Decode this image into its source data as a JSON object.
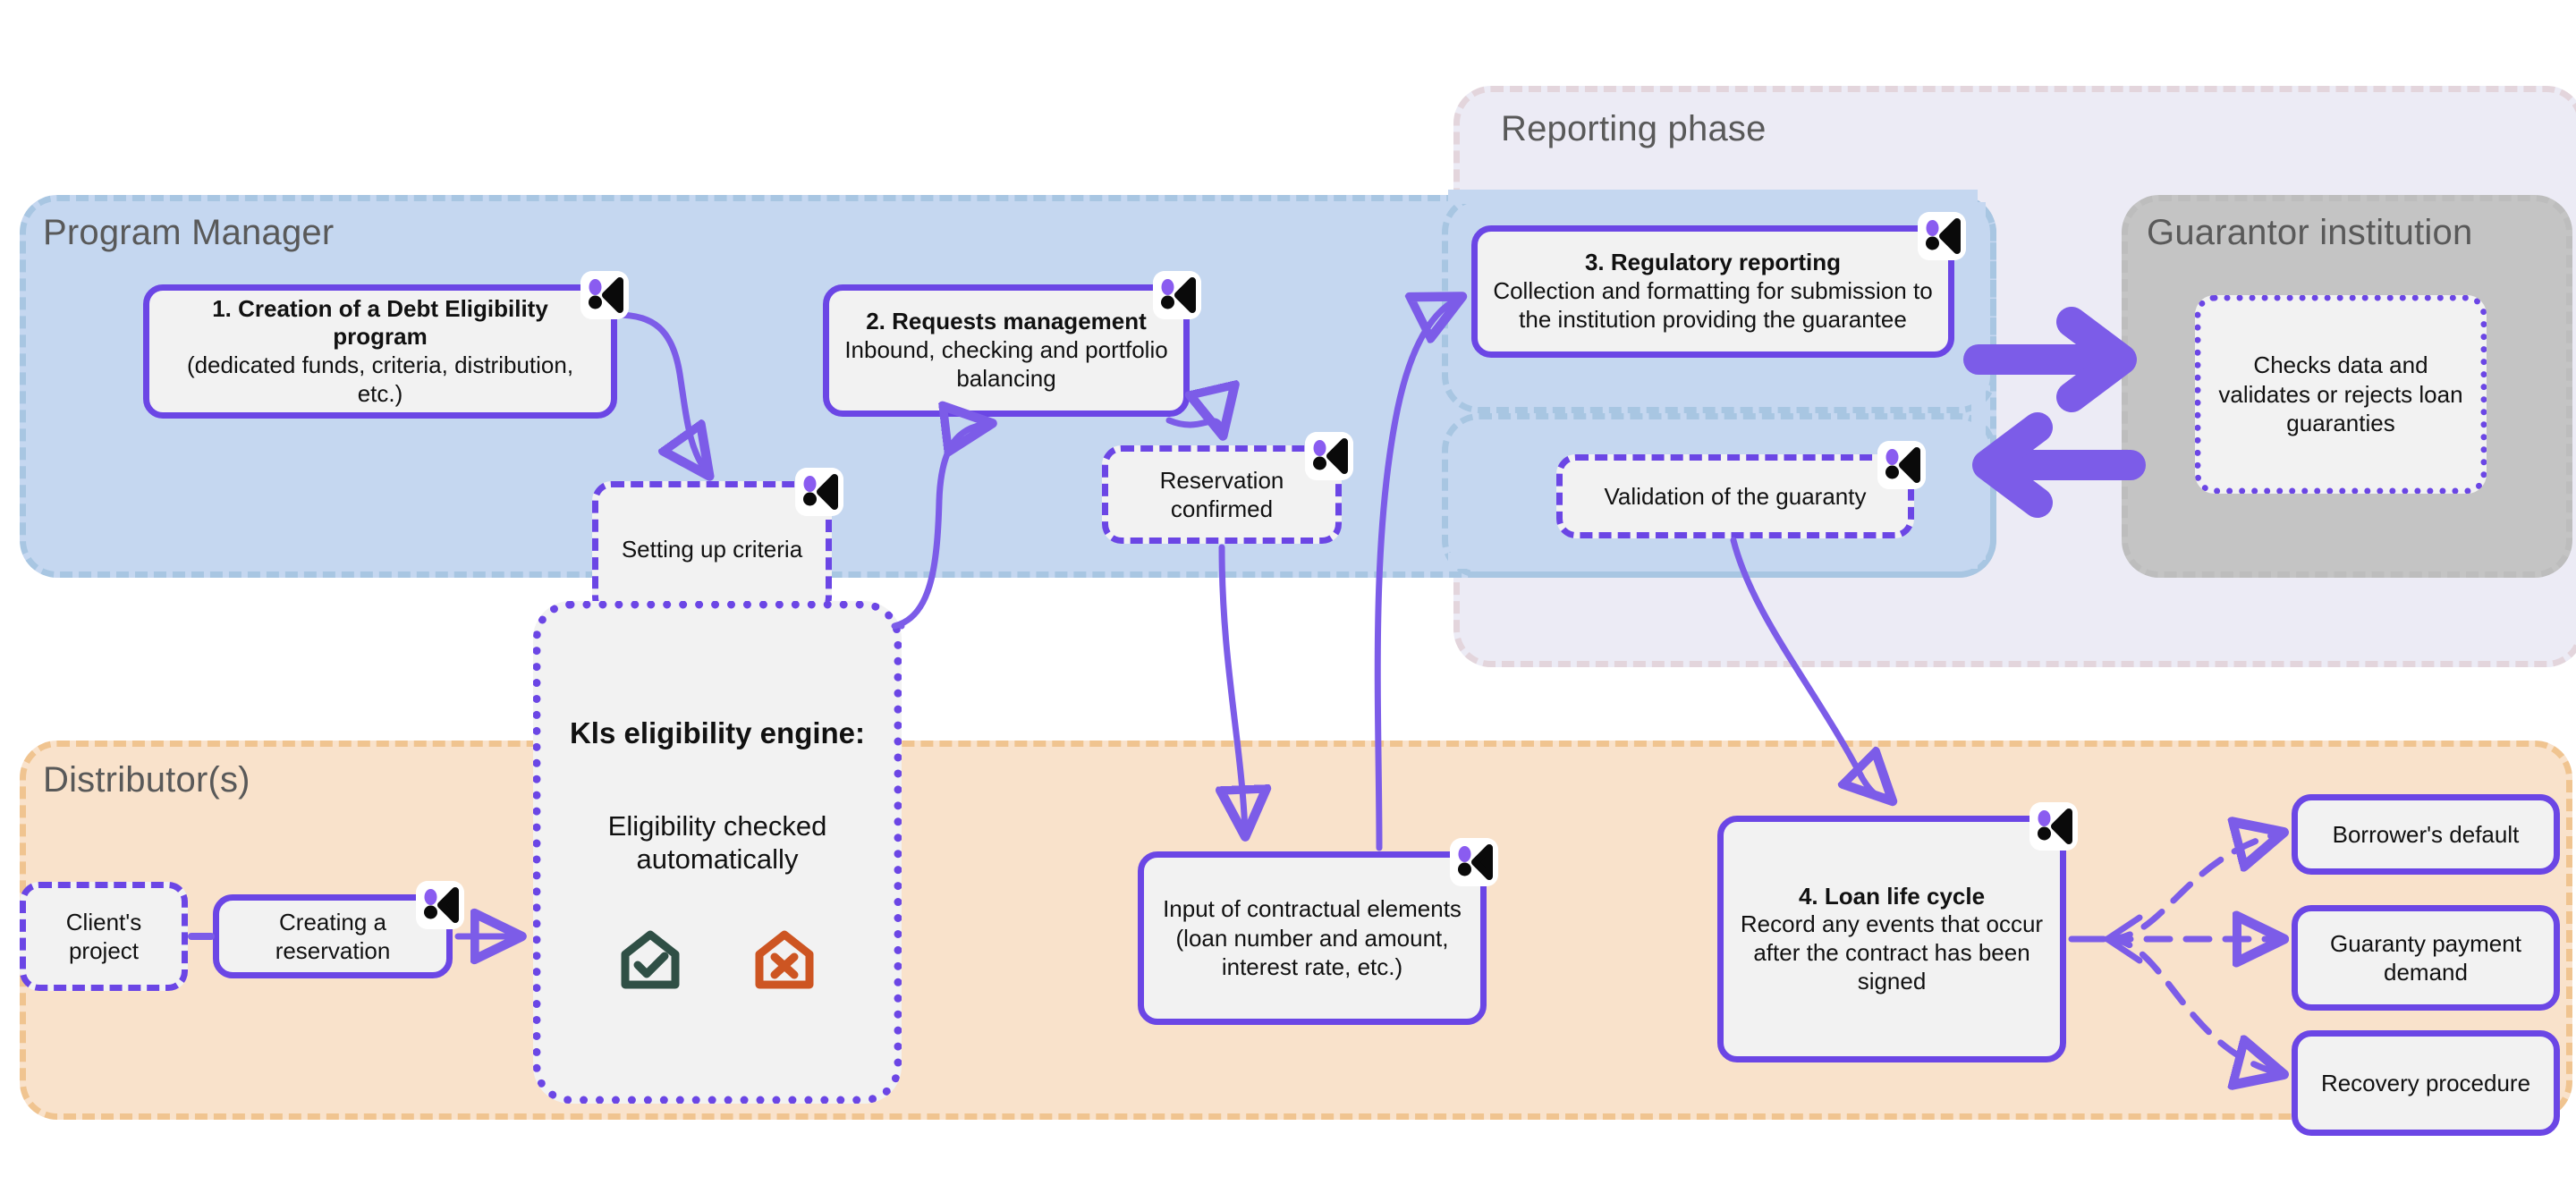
{
  "lanes": {
    "reporting": {
      "title": "Reporting phase",
      "fill": "#ecebf5",
      "stroke": "#e3d5dc"
    },
    "program": {
      "title": "Program Manager",
      "fill": "#c5d7f0",
      "stroke": "#a8c6e2"
    },
    "guarantor": {
      "title": "Guarantor institution",
      "fill": "#c4c4c4",
      "stroke": "#bdbdbd"
    },
    "distributor": {
      "title": "Distributor(s)",
      "fill": "#f9e2cb",
      "stroke": "#f0c490"
    }
  },
  "nodes": {
    "creation": {
      "title": "1. Creation of a Debt Eligibility program",
      "subtitle": "(dedicated funds, criteria, distribution, etc.)"
    },
    "requests": {
      "title": "2. Requests management",
      "subtitle": "Inbound, checking and portfolio balancing"
    },
    "regulatory": {
      "title": "3. Regulatory reporting",
      "subtitle": "Collection and formatting for submission to the institution providing the guarantee"
    },
    "loan_cycle": {
      "title": "4. Loan life cycle",
      "subtitle": "Record any events that occur after the contract has been signed"
    },
    "setting_criteria": {
      "label": "Setting up criteria"
    },
    "reservation_confirmed": {
      "label": "Reservation confirmed"
    },
    "validation_guaranty": {
      "label": "Validation of the guaranty"
    },
    "guarantor_check": {
      "label": "Checks data and validates or rejects loan guaranties"
    },
    "client_project": {
      "label": "Client's project"
    },
    "creating_reservation": {
      "label": "Creating a reservation"
    },
    "contractual_input": {
      "label": "Input of contractual elements (loan number and amount, interest rate, etc.)"
    },
    "borrower_default": {
      "label": "Borrower's default"
    },
    "guaranty_payment_demand": {
      "label": "Guaranty payment demand"
    },
    "recovery_procedure": {
      "label": "Recovery procedure"
    }
  },
  "engine": {
    "title": "Kls eligibility engine:",
    "subtitle": "Eligibility checked automatically",
    "icons": [
      {
        "name": "house-check-icon",
        "color": "#2f4f45"
      },
      {
        "name": "house-cross-icon",
        "color": "#cd5522"
      }
    ]
  },
  "badge": {
    "name": "kls-logo-badge",
    "dot_purple": "#8a5cf0",
    "dot_black": "#0a0a0a"
  },
  "colors": {
    "accent_purple": "#6b46e5",
    "arrow_purple": "#7c5ce8",
    "node_fill": "#f2f2f2",
    "text": "#111111",
    "lane_title": "#595959"
  }
}
